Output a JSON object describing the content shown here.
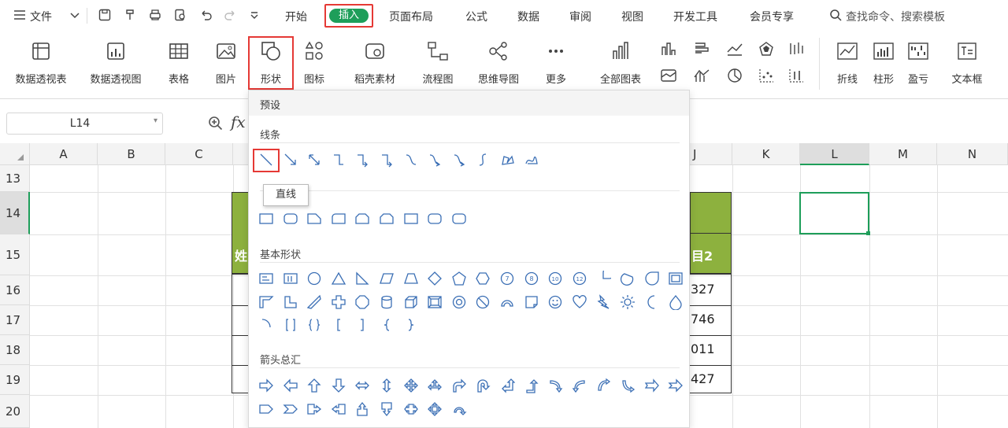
{
  "menubar": {
    "file_label": "文件",
    "tabs": [
      "开始",
      "插入",
      "页面布局",
      "公式",
      "数据",
      "审阅",
      "视图",
      "开发工具",
      "会员专享"
    ],
    "search_placeholder": "查找命令、搜索模板"
  },
  "ribbon": {
    "pivot_table": "数据透视表",
    "pivot_chart": "数据透视图",
    "table": "表格",
    "picture": "图片",
    "shape": "形状",
    "icon": "图标",
    "material": "稻壳素材",
    "flowchart": "流程图",
    "mindmap": "思维导图",
    "more": "更多",
    "all_charts": "全部图表",
    "line": "折线",
    "column": "柱形",
    "winloss": "盈亏",
    "textbox": "文本框"
  },
  "formula_bar": {
    "cell_ref": "L14",
    "fx": "fx"
  },
  "grid": {
    "columns": [
      "A",
      "B",
      "C",
      "J",
      "K",
      "L",
      "M",
      "N"
    ],
    "rows": [
      "13",
      "14",
      "15",
      "16",
      "17",
      "18",
      "19",
      "20"
    ],
    "header_partial_left": "姓",
    "header_partial_right": "目2",
    "j_values": [
      "327",
      "746",
      "011",
      "427"
    ]
  },
  "shape_menu": {
    "header": "预设",
    "sections": {
      "lines": "线条",
      "basic": "基本形状",
      "arrows": "箭头总汇"
    },
    "tooltip": "直线"
  },
  "colors": {
    "accent": "#1e9e5a",
    "highlight": "#e53935",
    "table_header": "#8db13e",
    "shape_icon": "#3b6fb5"
  }
}
